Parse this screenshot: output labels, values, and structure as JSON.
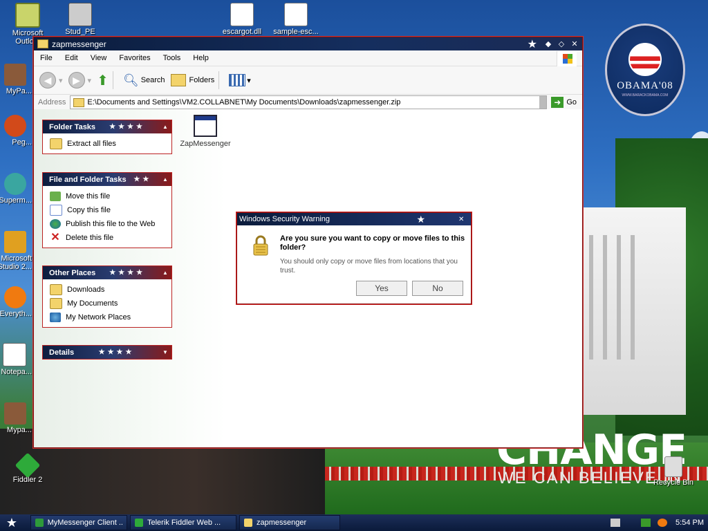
{
  "desktop": {
    "icons": [
      {
        "label": "Microsoft Outlo..."
      },
      {
        "label": "Stud_PE"
      },
      {
        "label": "escargot.dll"
      },
      {
        "label": "sample-esc..."
      },
      {
        "label": "MyPa..."
      },
      {
        "label": "Peg..."
      },
      {
        "label": "Superm..."
      },
      {
        "label": "Microsoft Studio 2..."
      },
      {
        "label": "Everyth..."
      },
      {
        "label": "Notepa..."
      },
      {
        "label": "Mypa..."
      },
      {
        "label": "Fiddler 2"
      },
      {
        "label": "Recycle Bin"
      }
    ],
    "badge_text": "OBAMA'08",
    "badge_sub": "WWW.BARACKOBAMA.COM",
    "slogan_big": "CHANGE",
    "slogan_small": "WE CAN BELIEVE IN"
  },
  "window": {
    "title": "zapmessenger",
    "menu": [
      "File",
      "Edit",
      "View",
      "Favorites",
      "Tools",
      "Help"
    ],
    "toolbar": {
      "search": "Search",
      "folders": "Folders"
    },
    "address": {
      "label": "Address",
      "value": "E:\\Documents and Settings\\VM2.COLLABNET\\My Documents\\Downloads\\zapmessenger.zip",
      "go": "Go"
    },
    "panels": {
      "folder_tasks": {
        "title": "Folder Tasks",
        "items": [
          "Extract all files"
        ]
      },
      "file_tasks": {
        "title": "File and Folder Tasks",
        "items": [
          "Move this file",
          "Copy this file",
          "Publish this file to the Web",
          "Delete this file"
        ]
      },
      "other_places": {
        "title": "Other Places",
        "items": [
          "Downloads",
          "My Documents",
          "My Network Places"
        ]
      },
      "details": {
        "title": "Details"
      }
    },
    "file": {
      "label": "ZapMessenger"
    }
  },
  "dialog": {
    "title": "Windows Security Warning",
    "question": "Are you sure you want to copy or move files to this folder?",
    "subtext": "You should only copy or move files from locations that you trust.",
    "yes": "Yes",
    "no": "No"
  },
  "taskbar": {
    "tasks": [
      "MyMessenger Client ...",
      "Telerik Fiddler Web ...",
      "zapmessenger"
    ],
    "clock": "5:54 PM"
  }
}
